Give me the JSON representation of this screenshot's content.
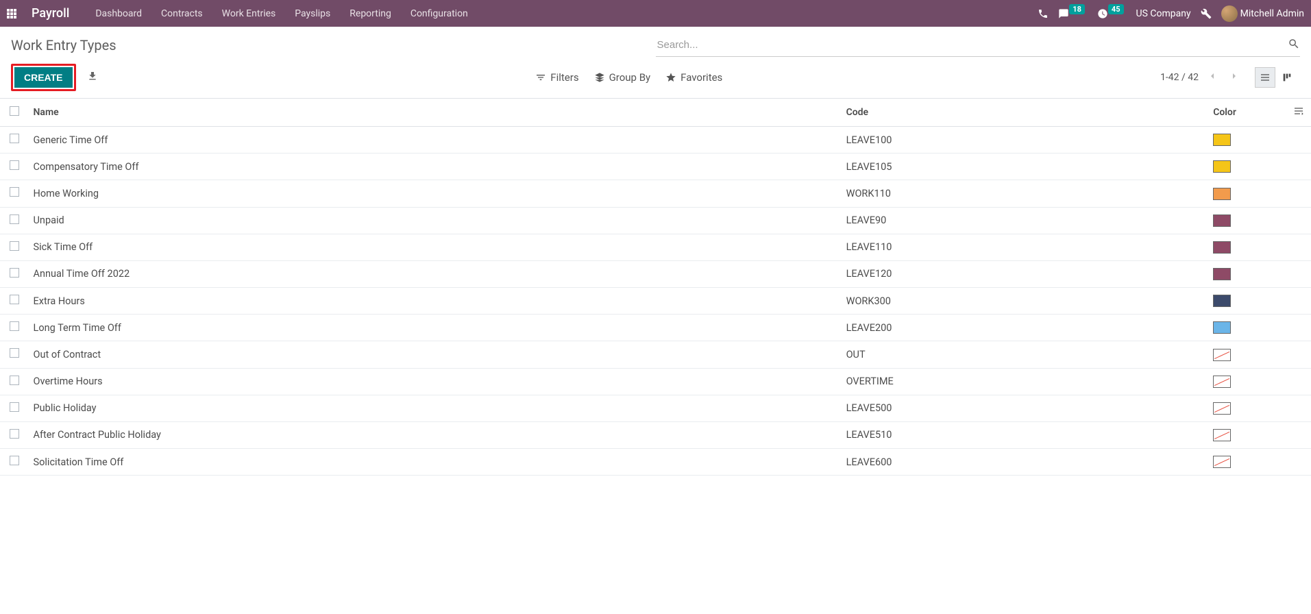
{
  "navbar": {
    "app_title": "Payroll",
    "menu": [
      "Dashboard",
      "Contracts",
      "Work Entries",
      "Payslips",
      "Reporting",
      "Configuration"
    ],
    "messages_badge": "18",
    "activities_badge": "45",
    "company": "US Company",
    "user": "Mitchell Admin"
  },
  "header": {
    "title": "Work Entry Types",
    "search_placeholder": "Search...",
    "create_label": "CREATE",
    "filters_label": "Filters",
    "groupby_label": "Group By",
    "favorites_label": "Favorites",
    "pager": "1-42 / 42"
  },
  "table": {
    "columns": {
      "name": "Name",
      "code": "Code",
      "color": "Color"
    },
    "rows": [
      {
        "name": "Generic Time Off",
        "code": "LEAVE100",
        "color": "#f5c518"
      },
      {
        "name": "Compensatory Time Off",
        "code": "LEAVE105",
        "color": "#f5c518"
      },
      {
        "name": "Home Working",
        "code": "WORK110",
        "color": "#f29b4c"
      },
      {
        "name": "Unpaid",
        "code": "LEAVE90",
        "color": "#8e4a66"
      },
      {
        "name": "Sick Time Off",
        "code": "LEAVE110",
        "color": "#8e4a66"
      },
      {
        "name": "Annual Time Off 2022",
        "code": "LEAVE120",
        "color": "#8e4a66"
      },
      {
        "name": "Extra Hours",
        "code": "WORK300",
        "color": "#3c4a6b"
      },
      {
        "name": "Long Term Time Off",
        "code": "LEAVE200",
        "color": "#6bb5e8"
      },
      {
        "name": "Out of Contract",
        "code": "OUT",
        "color": null
      },
      {
        "name": "Overtime Hours",
        "code": "OVERTIME",
        "color": null
      },
      {
        "name": "Public Holiday",
        "code": "LEAVE500",
        "color": null
      },
      {
        "name": "After Contract Public Holiday",
        "code": "LEAVE510",
        "color": null
      },
      {
        "name": "Solicitation Time Off",
        "code": "LEAVE600",
        "color": null
      }
    ]
  }
}
